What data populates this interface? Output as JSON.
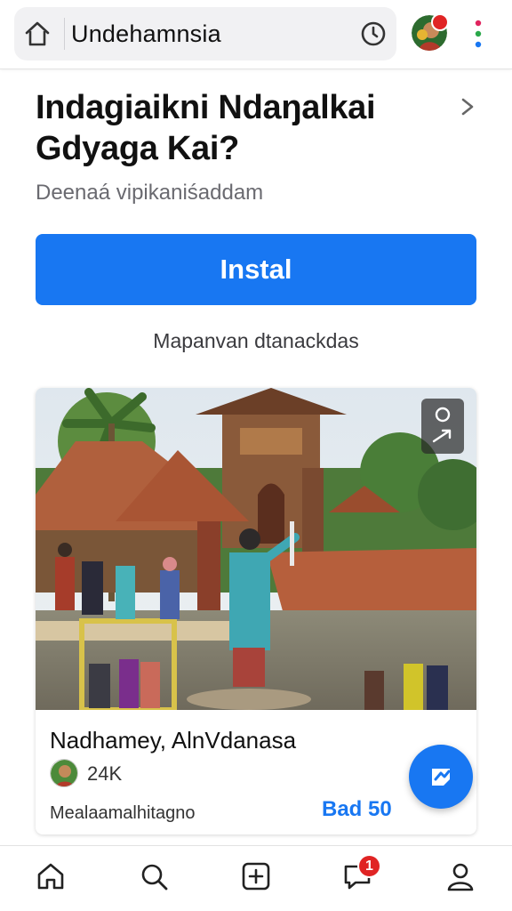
{
  "browser": {
    "url_text": "Undehamnsia",
    "icons": {
      "home": "home-icon",
      "history": "clock-icon",
      "avatar": "profile-avatar",
      "menu": "more-vert-icon"
    }
  },
  "header": {
    "title": "Indagiaikni Ndaŋalkai Gdyaga Kai?",
    "subtitle": "Deenaá vipikaniśaddam",
    "install_label": "Instal",
    "caption": "Mapanvan dtanackdas"
  },
  "card": {
    "title": "Nadhamey, AlnVdanasa",
    "count": "24K",
    "footer_left": "Mealaamalhitagno",
    "footer_right": "Bad 50"
  },
  "bottom_nav": {
    "items": [
      "home",
      "search",
      "create",
      "notifications",
      "profile"
    ],
    "notification_badge": "1"
  },
  "colors": {
    "accent": "#1877f2",
    "badge": "#e02424",
    "text": "#111111",
    "muted": "#6a6a70"
  }
}
